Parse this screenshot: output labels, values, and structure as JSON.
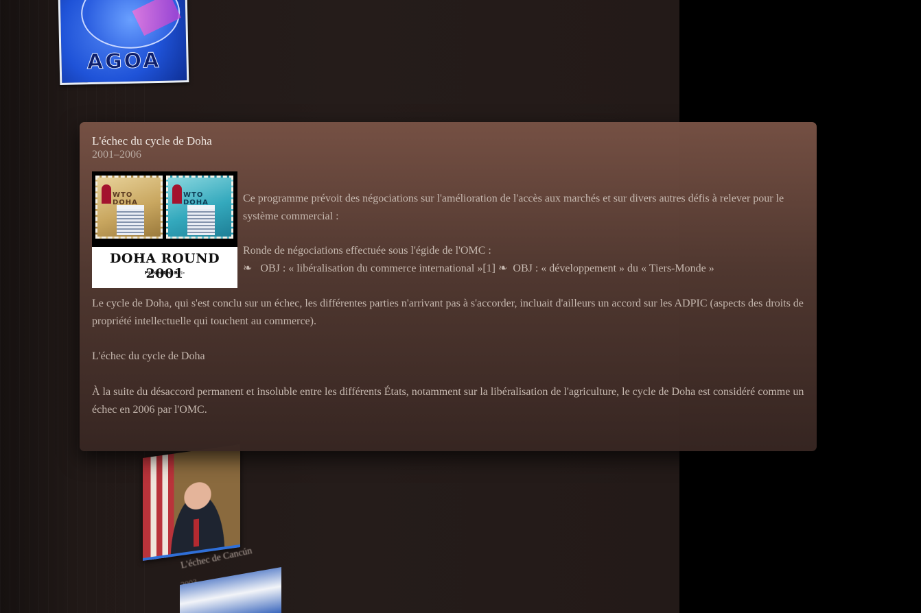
{
  "card": {
    "title": "L'échec du cycle de Doha",
    "dates": "2001–2006",
    "image": {
      "banner_title": "DOHA ROUND 2001",
      "presented_by": "Presented By:-",
      "stamp_label": "WTO DOHA"
    },
    "intro": "Ce programme prévoit des négociations sur l'amélioration de l'accès aux marchés et sur divers autres défis à relever pour le système commercial :",
    "ronde": "Ronde de négociations effectuée sous l'égide de l'OMC :",
    "obj_line": {
      "bullet": "❧",
      "obj1": "OBJ : « libéralisation du commerce international »[1]",
      "obj2": "OBJ : « développement » du « Tiers-Monde »"
    },
    "conclusion": "Le cycle de Doha, qui s'est conclu sur un échec, les différentes parties n'arrivant pas à s'accorder, incluait d'ailleurs un accord sur les ADPIC (aspects des droits de propriété intellectuelle qui touchent au commerce).",
    "subheading": "L'échec du cycle de Doha",
    "final": "À la suite du désaccord permanent et insoluble entre les différents États, notamment sur la libéralisation de l'agriculture, le cycle de Doha est considéré comme un échec en 2006 par l'OMC."
  },
  "background": {
    "agoa_label": "AGOA",
    "cancun_heading": "L'échec de Cancún",
    "cancun_year": "2003"
  },
  "colors": {
    "card_top": "#785245",
    "card_bottom": "#372622",
    "page_bg": "#000000",
    "text": "#c6b8af"
  }
}
